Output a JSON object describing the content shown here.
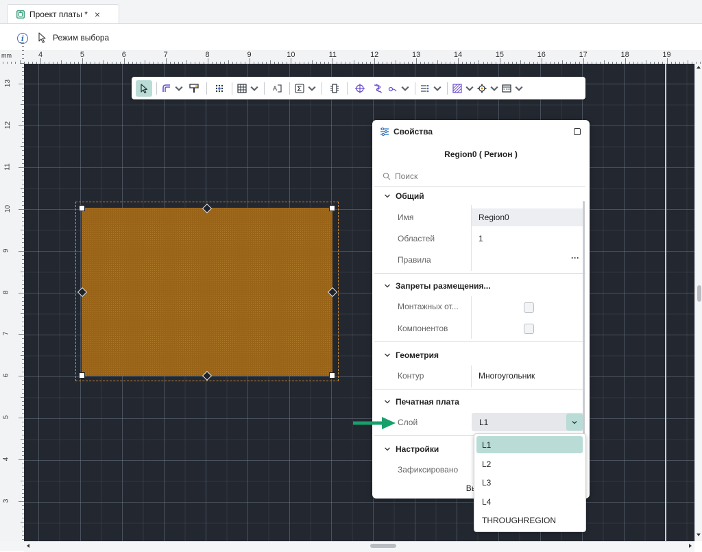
{
  "tab": {
    "title": "Проект платы *",
    "close": "×"
  },
  "status": {
    "mode_label": "Режим выбора"
  },
  "ruler": {
    "unit": "mm",
    "top_labels": [
      "4",
      "5",
      "6",
      "7",
      "8",
      "9",
      "10",
      "11",
      "12",
      "13",
      "14",
      "15",
      "16",
      "17",
      "18",
      "19"
    ],
    "left_labels": [
      "13",
      "12",
      "11",
      "10",
      "9",
      "8",
      "7",
      "6",
      "5",
      "4",
      "3"
    ]
  },
  "toolbar": {
    "tools": [
      "select-tool",
      "route-tool",
      "pin-tool",
      "via-array-tool",
      "table-tool",
      "text-tool",
      "sum-tool",
      "component-tool",
      "target-tool",
      "diff-pair-tool",
      "probe-tool",
      "bus-tool",
      "hatch-tool",
      "gear-tool",
      "layer-stack-tool"
    ]
  },
  "properties": {
    "title": "Свойства",
    "object": "Region0 ( Регион )",
    "search_placeholder": "Поиск",
    "sections": {
      "general": {
        "title": "Общий",
        "name_label": "Имя",
        "name_value": "Region0",
        "areas_label": "Областей",
        "areas_value": "1",
        "rules_label": "Правила",
        "rules_value": "···"
      },
      "placement": {
        "title": "Запреты размещения...",
        "holes_label": "Монтажных от...",
        "components_label": "Компонентов"
      },
      "geometry": {
        "title": "Геометрия",
        "contour_label": "Контур",
        "contour_value": "Многоугольник"
      },
      "pcb": {
        "title": "Печатная плата",
        "layer_label": "Слой",
        "layer_value": "L1"
      },
      "settings": {
        "title": "Настройки",
        "fixed_label": "Зафиксировано"
      }
    },
    "footer": "Выделе"
  },
  "layer_options": [
    "L1",
    "L2",
    "L3",
    "L4",
    "THROUGHREGION"
  ],
  "colors": {
    "accent": "#b9dcd6",
    "canvas": "#232830",
    "region": "#9a6418",
    "arrow": "#16a06b"
  }
}
